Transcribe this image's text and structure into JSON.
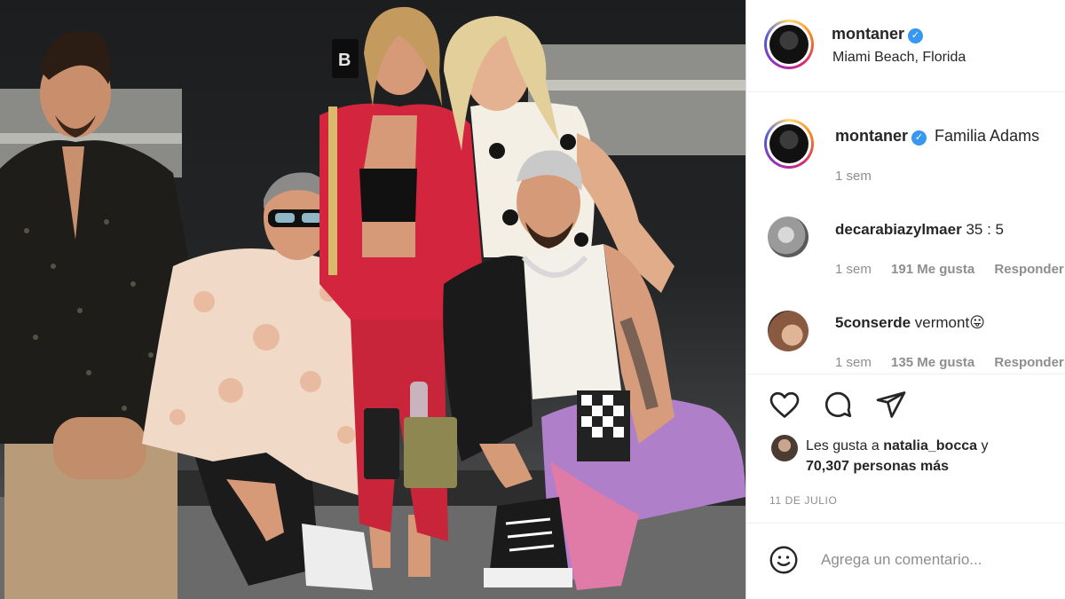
{
  "post": {
    "author": "montaner",
    "verified_mark": "✓",
    "location": "Miami Beach, Florida"
  },
  "caption": {
    "username": "montaner",
    "text": "Familia Adams",
    "time": "1 sem"
  },
  "comments": [
    {
      "username": "decarabiazylmaer",
      "text": "35 : 5",
      "time": "1 sem",
      "likes": "191 Me gusta",
      "reply": "Responder"
    },
    {
      "username": "5conserde",
      "text": "vermont😛",
      "time": "1 sem",
      "likes": "135 Me gusta",
      "reply": "Responder"
    }
  ],
  "actions": {
    "like_icon": "heart-icon",
    "comment_icon": "comment-bubble-icon",
    "share_icon": "paper-plane-icon"
  },
  "liked_by": {
    "prefix": "Les gusta a",
    "user": "natalia_bocca",
    "joiner": "y",
    "others": "70,307 personas más"
  },
  "post_date": "11 DE JULIO",
  "add_comment": {
    "placeholder": "Agrega un comentario...",
    "emoji_icon": "smiley-icon"
  },
  "colors": {
    "verified": "#3897f0",
    "text": "#262626",
    "muted": "#8e8e8e"
  }
}
